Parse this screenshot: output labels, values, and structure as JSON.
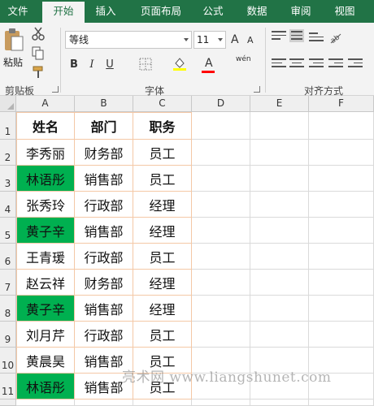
{
  "tabs": [
    "文件",
    "开始",
    "插入",
    "页面布局",
    "公式",
    "数据",
    "审阅",
    "视图"
  ],
  "active_tab": "开始",
  "ribbon": {
    "clipboard": {
      "paste_label": "粘贴",
      "group_label": "剪贴板"
    },
    "font": {
      "font_name": "等线",
      "font_size": "11",
      "group_label": "字体",
      "bold": "B",
      "italic": "I",
      "underline": "U",
      "grow": "A",
      "shrink": "A",
      "font_color_glyph": "A",
      "phonetic_glyph": "wén",
      "font_color_bar": "#ff0000",
      "fill_color_bar": "#ffff00"
    },
    "alignment": {
      "group_label": "对齐方式"
    }
  },
  "columns": [
    "A",
    "B",
    "C",
    "D",
    "E",
    "F"
  ],
  "rows": [
    "1",
    "2",
    "3",
    "4",
    "5",
    "6",
    "7",
    "8",
    "9",
    "10",
    "11"
  ],
  "table": {
    "header": [
      "姓名",
      "部门",
      "职务"
    ],
    "rows": [
      [
        "李秀丽",
        "财务部",
        "员工"
      ],
      [
        "林语彤",
        "销售部",
        "员工"
      ],
      [
        "张秀玲",
        "行政部",
        "经理"
      ],
      [
        "黄子辛",
        "销售部",
        "经理"
      ],
      [
        "王青瑗",
        "行政部",
        "员工"
      ],
      [
        "赵云祥",
        "财务部",
        "经理"
      ],
      [
        "黄子辛",
        "销售部",
        "经理"
      ],
      [
        "刘月芹",
        "行政部",
        "员工"
      ],
      [
        "黄晨昊",
        "销售部",
        "员工"
      ],
      [
        "林语彤",
        "销售部",
        "员工"
      ]
    ],
    "highlighted_rows": [
      2,
      4,
      7,
      10
    ]
  },
  "colors": {
    "ribbon_green": "#217346",
    "highlight": "#00b050",
    "table_border": "#f4c8a6"
  },
  "watermark": "亮术网 www.liangshunet.com"
}
